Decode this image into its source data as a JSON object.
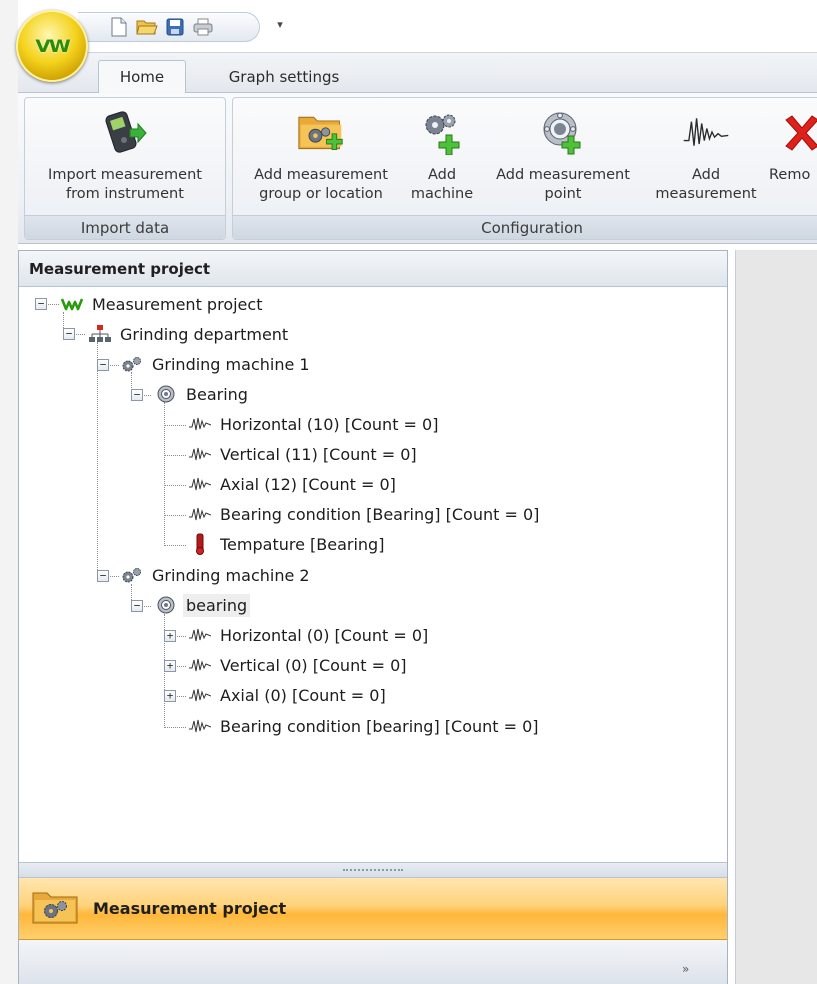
{
  "app": {
    "logo_text": "VW"
  },
  "tabs": [
    {
      "label": "Home",
      "active": true
    },
    {
      "label": "Graph settings",
      "active": false
    }
  ],
  "ribbon": {
    "groups": [
      {
        "caption": "Import data",
        "buttons": [
          {
            "label": "Import measurement\nfrom instrument",
            "icon": "instrument-import-icon"
          }
        ]
      },
      {
        "caption": "Configuration",
        "buttons": [
          {
            "label": "Add measurement\ngroup or location",
            "icon": "folder-add-icon"
          },
          {
            "label": "Add\nmachine",
            "icon": "machine-add-icon"
          },
          {
            "label": "Add measurement\npoint",
            "icon": "bearing-add-icon"
          },
          {
            "label": "Add\nmeasurement",
            "icon": "waveform-icon"
          },
          {
            "label": "Remo",
            "icon": "remove-icon"
          }
        ]
      }
    ]
  },
  "panel": {
    "title": "Measurement project",
    "tree": [
      {
        "label": "Measurement project",
        "icon": "project-icon"
      },
      {
        "label": "Grinding department",
        "icon": "department-icon"
      },
      {
        "label": "Grinding machine 1",
        "icon": "machine-icon"
      },
      {
        "label": "Bearing",
        "icon": "bearing-icon"
      },
      {
        "label": "Horizontal (10) [Count = 0]",
        "icon": "waveform-icon"
      },
      {
        "label": "Vertical (11) [Count = 0]",
        "icon": "waveform-icon"
      },
      {
        "label": "Axial (12) [Count = 0]",
        "icon": "waveform-icon"
      },
      {
        "label": "Bearing condition [Bearing] [Count = 0]",
        "icon": "waveform-icon"
      },
      {
        "label": "Tempature [Bearing]",
        "icon": "thermometer-icon"
      },
      {
        "label": "Grinding machine 2",
        "icon": "machine-icon"
      },
      {
        "label": "bearing",
        "icon": "bearing-icon"
      },
      {
        "label": "Horizontal (0) [Count = 0]",
        "icon": "waveform-icon"
      },
      {
        "label": "Vertical (0) [Count = 0]",
        "icon": "waveform-icon"
      },
      {
        "label": "Axial (0) [Count = 0]",
        "icon": "waveform-icon"
      },
      {
        "label": "Bearing condition [bearing] [Count = 0]",
        "icon": "waveform-icon"
      }
    ]
  },
  "navigation": {
    "active_label": "Measurement project",
    "chevron": "»"
  },
  "colors": {
    "nav_active": "#ffc35a",
    "logo_green": "#2a8d0a",
    "remove_red": "#e0201a"
  }
}
